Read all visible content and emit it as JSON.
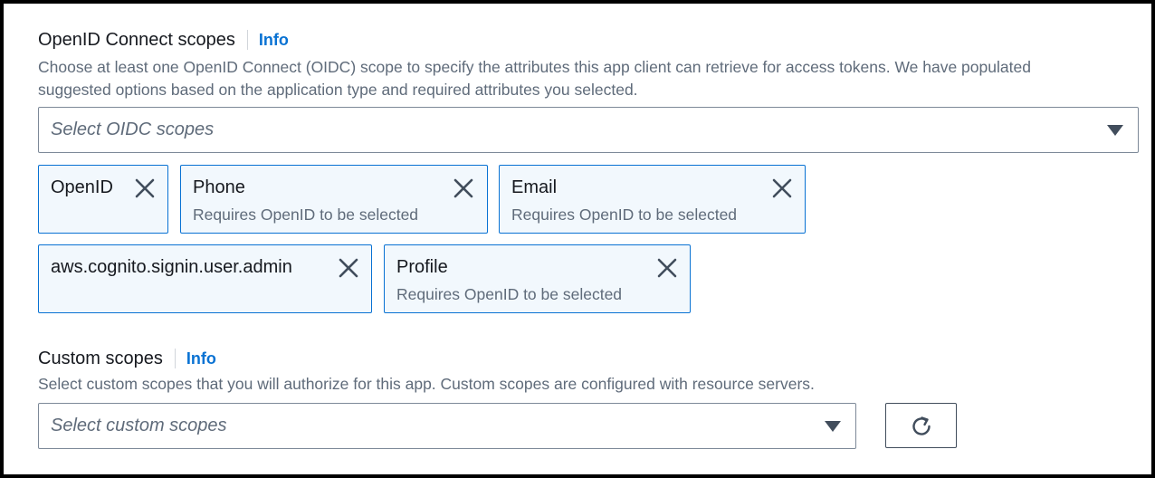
{
  "oidc": {
    "label": "OpenID Connect scopes",
    "info": "Info",
    "description_line1": "Choose at least one OpenID Connect (OIDC) scope to specify the attributes this app client can retrieve for access tokens. We have populated",
    "description_line2": "suggested options based on the application type and required attributes you selected.",
    "select_placeholder": "Select OIDC scopes",
    "tokens": [
      {
        "label": "OpenID",
        "sub": ""
      },
      {
        "label": "Phone",
        "sub": "Requires OpenID to be selected"
      },
      {
        "label": "Email",
        "sub": "Requires OpenID to be selected"
      },
      {
        "label": "aws.cognito.signin.user.admin",
        "sub": ""
      },
      {
        "label": "Profile",
        "sub": "Requires OpenID to be selected"
      }
    ]
  },
  "custom": {
    "label": "Custom scopes",
    "info": "Info",
    "description": "Select custom scopes that you will authorize for this app. Custom scopes are configured with resource servers.",
    "select_placeholder": "Select custom scopes"
  },
  "icons": {
    "dismiss": "close-icon",
    "dropdown": "caret-down-icon",
    "refresh": "refresh-icon"
  },
  "colors": {
    "link": "#0972d3",
    "token_border": "#0972d3",
    "token_bg": "#f2f8fd",
    "muted_text": "#5f6b7a"
  }
}
